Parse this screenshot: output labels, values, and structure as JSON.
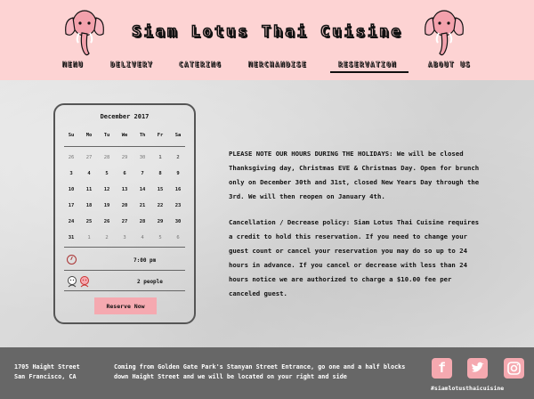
{
  "header": {
    "title": "Siam Lotus Thai Cuisine",
    "nav": [
      {
        "label": "MENU"
      },
      {
        "label": "DELIVERY"
      },
      {
        "label": "CATERING"
      },
      {
        "label": "MERCHANDISE"
      },
      {
        "label": "RESERVATION",
        "active": true
      },
      {
        "label": "ABOUT US"
      }
    ],
    "brand_color": "#fdd3d3"
  },
  "calendar": {
    "month": "December 2017",
    "weekdays": [
      "Su",
      "Mo",
      "Tu",
      "We",
      "Th",
      "Fr",
      "Sa"
    ],
    "weeks": [
      [
        "26",
        "27",
        "28",
        "29",
        "30",
        "1",
        "2"
      ],
      [
        "3",
        "4",
        "5",
        "6",
        "7",
        "8",
        "9"
      ],
      [
        "10",
        "11",
        "12",
        "13",
        "14",
        "15",
        "16"
      ],
      [
        "17",
        "18",
        "19",
        "20",
        "21",
        "22",
        "23"
      ],
      [
        "24",
        "25",
        "26",
        "27",
        "28",
        "29",
        "30"
      ],
      [
        "31",
        "1",
        "2",
        "3",
        "4",
        "5",
        "6"
      ]
    ],
    "time": "7:00 pm",
    "people": "2 people",
    "reserve_label": "Reserve Now",
    "accent": "#f5a9b0"
  },
  "content": {
    "notice": "PLEASE NOTE OUR HOURS DURING THE HOLIDAYS: We will be closed Thanksgiving day, Christmas EVE & Christmas Day. Open for brunch only on December 30th and 31st, closed New Years Day through the 3rd. We will then reopen on January 4th.",
    "policy": "Cancellation / Decrease policy: Siam Lotus Thai Cuisine requires a credit to hold this reservation. If you need to change your guest count or cancel your reservation you may do so up to 24 hours in advance. If you cancel or decrease with less than 24 hours notice we are authorized to charge a $10.00 fee per canceled guest."
  },
  "footer": {
    "address_line1": "1705 Haight Street",
    "address_line2": "San Francisco, CA",
    "directions": "Coming from Golden Gate Park's Stanyan Street Entrance, go one and a half blocks down Haight Street and we will be located on your right and side",
    "social": [
      "facebook-icon",
      "twitter-icon",
      "instagram-icon"
    ],
    "hashtag": "#siamlotusthaicuisine"
  }
}
